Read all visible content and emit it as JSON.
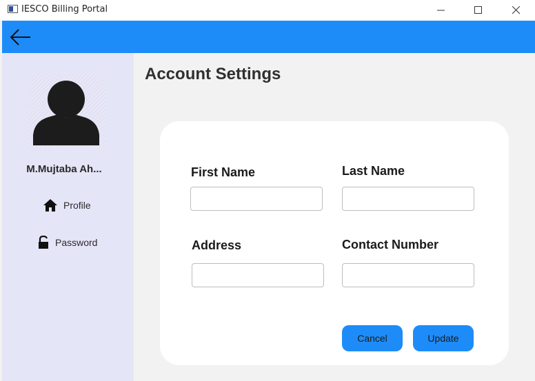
{
  "window": {
    "title": "IESCO Billing Portal",
    "icons": {
      "app": "app-window-icon",
      "minimize": "minimize-icon",
      "maximize": "maximize-icon",
      "close": "close-icon"
    }
  },
  "header": {
    "back_icon": "arrow-left-icon",
    "color": "#1e8cf8"
  },
  "sidebar": {
    "user_name": "M.Mujtaba Ah...",
    "avatar_icon": "user-avatar-icon",
    "items": [
      {
        "label": "Profile",
        "icon": "home-icon"
      },
      {
        "label": "Password",
        "icon": "lock-icon"
      }
    ],
    "background": "#e5e5f8"
  },
  "main": {
    "title": "Account Settings",
    "form": {
      "first_name": {
        "label": "First Name",
        "value": ""
      },
      "last_name": {
        "label": "Last Name",
        "value": ""
      },
      "address": {
        "label": "Address",
        "value": ""
      },
      "contact_number": {
        "label": "Contact Number",
        "value": ""
      }
    },
    "buttons": {
      "cancel": "Cancel",
      "update": "Update"
    }
  }
}
